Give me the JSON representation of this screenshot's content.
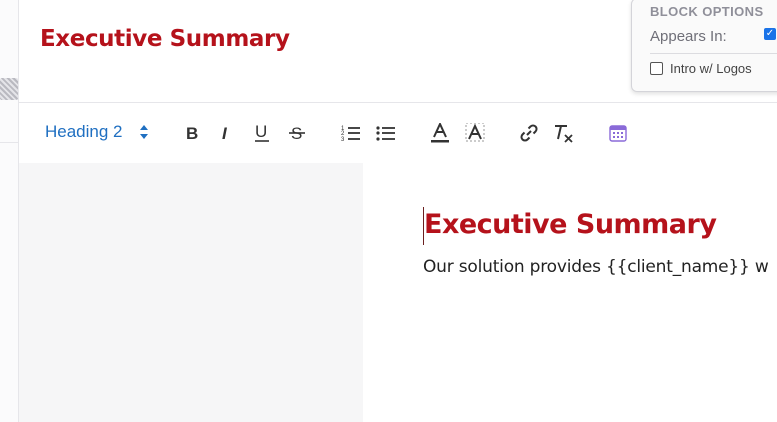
{
  "header": {
    "title": "Executive Summary"
  },
  "block_options": {
    "title": "BLOCK OPTIONS",
    "appears_in_label": "Appears In:",
    "appears_in_checked": true,
    "intro_label": "Intro w/ Logos",
    "intro_checked": false
  },
  "toolbar": {
    "style_select": "Heading 2",
    "buttons": [
      "bold-icon",
      "italic-icon",
      "underline-icon",
      "strikethrough-icon",
      "ordered-list-icon",
      "bullet-list-icon",
      "text-color-icon",
      "highlight-icon",
      "link-icon",
      "clear-format-icon",
      "calendar-icon"
    ],
    "colors": {
      "accent": "#1f6fc1",
      "calendar": "#8a6ad8"
    }
  },
  "document": {
    "heading": "Executive Summary",
    "body": "Our solution provides {{client_name}} w"
  },
  "colors": {
    "brand": "#b5121b"
  }
}
